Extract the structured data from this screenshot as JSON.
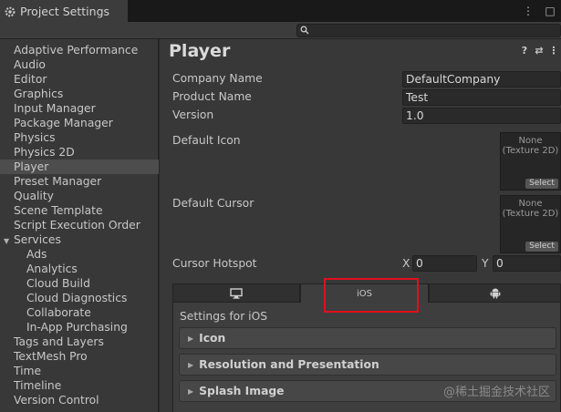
{
  "window": {
    "tab_title": "Project Settings",
    "menu_icon": "kebab-menu-icon",
    "maximize_icon": "maximize-icon"
  },
  "search": {
    "placeholder": ""
  },
  "sidebar": {
    "items": [
      {
        "label": "Adaptive Performance",
        "kind": "item"
      },
      {
        "label": "Audio",
        "kind": "item"
      },
      {
        "label": "Editor",
        "kind": "item"
      },
      {
        "label": "Graphics",
        "kind": "item"
      },
      {
        "label": "Input Manager",
        "kind": "item"
      },
      {
        "label": "Package Manager",
        "kind": "item"
      },
      {
        "label": "Physics",
        "kind": "item"
      },
      {
        "label": "Physics 2D",
        "kind": "item"
      },
      {
        "label": "Player",
        "kind": "item",
        "selected": true
      },
      {
        "label": "Preset Manager",
        "kind": "item"
      },
      {
        "label": "Quality",
        "kind": "item"
      },
      {
        "label": "Scene Template",
        "kind": "item"
      },
      {
        "label": "Script Execution Order",
        "kind": "item"
      },
      {
        "label": "Services",
        "kind": "group"
      },
      {
        "label": "Ads",
        "kind": "child"
      },
      {
        "label": "Analytics",
        "kind": "child"
      },
      {
        "label": "Cloud Build",
        "kind": "child"
      },
      {
        "label": "Cloud Diagnostics",
        "kind": "child"
      },
      {
        "label": "Collaborate",
        "kind": "child"
      },
      {
        "label": "In-App Purchasing",
        "kind": "child"
      },
      {
        "label": "Tags and Layers",
        "kind": "item"
      },
      {
        "label": "TextMesh Pro",
        "kind": "item"
      },
      {
        "label": "Time",
        "kind": "item"
      },
      {
        "label": "Timeline",
        "kind": "item"
      },
      {
        "label": "Version Control",
        "kind": "item"
      }
    ]
  },
  "main": {
    "title": "Player",
    "company_name_label": "Company Name",
    "company_name_value": "DefaultCompany",
    "product_name_label": "Product Name",
    "product_name_value": "Test",
    "version_label": "Version",
    "version_value": "1.0",
    "default_icon_label": "Default Icon",
    "default_cursor_label": "Default Cursor",
    "texture_none_line1": "None",
    "texture_none_line2": "(Texture 2D)",
    "select_label": "Select",
    "cursor_hotspot_label": "Cursor Hotspot",
    "hotspot_x_label": "X",
    "hotspot_x_value": "0",
    "hotspot_y_label": "Y",
    "hotspot_y_value": "0",
    "platform_tabs": [
      {
        "label": "",
        "icon": "monitor-icon"
      },
      {
        "label": "iOS",
        "icon": ""
      },
      {
        "label": "",
        "icon": "android-icon"
      }
    ],
    "settings_for": "Settings for iOS",
    "foldouts": [
      {
        "label": "Icon"
      },
      {
        "label": "Resolution and Presentation"
      },
      {
        "label": "Splash Image"
      }
    ]
  },
  "watermark": "@稀土掘金技术社区",
  "colors": {
    "highlight": "#e0101b",
    "selected_row": "#4d4d4d"
  }
}
